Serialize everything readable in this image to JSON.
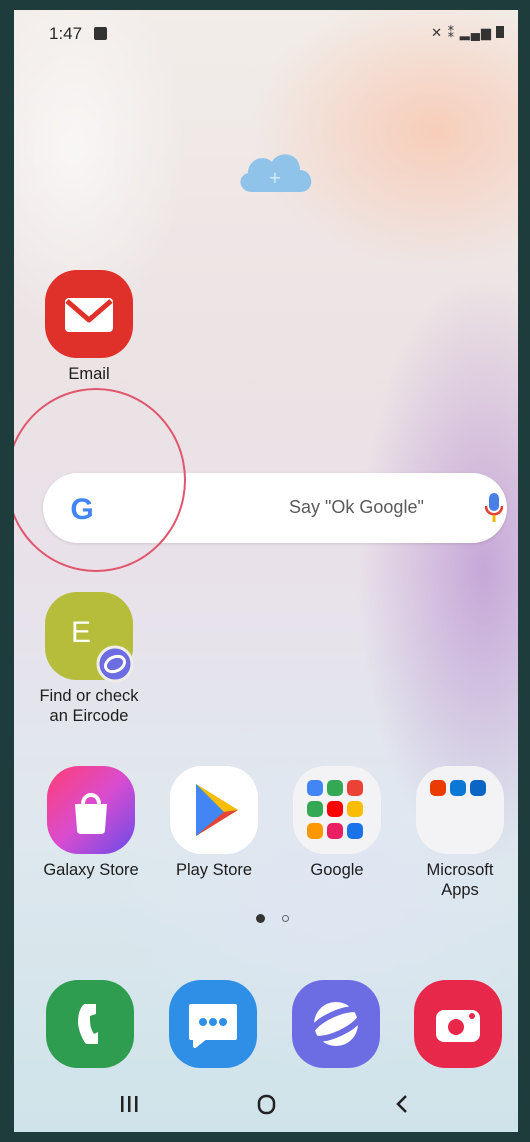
{
  "status_bar": {
    "time": "1:47",
    "notification_icon": "gallery-icon",
    "system_icons": [
      "mute-icon",
      "wifi-calling-icon",
      "signal-icon",
      "battery-icon"
    ]
  },
  "home": {
    "cloud_widget": {
      "icon": "cloud-add-icon",
      "color": "#8fc3ea"
    },
    "email": {
      "label": "Email",
      "color": "#e0302a"
    },
    "search_bar": {
      "brand": "G",
      "hint": "Say \"Ok Google\"",
      "mic_color": "#4a7fe5"
    },
    "eircode": {
      "letter": "E",
      "line1": "Find or check",
      "line2": "an Eircode",
      "color": "#b6bd3a",
      "badge_color": "#6c6de3"
    },
    "apps": [
      {
        "name": "galaxy-store",
        "label": "Galaxy Store",
        "color": "#ff3e73"
      },
      {
        "name": "play-store",
        "label": "Play Store",
        "color": "#ffffff"
      },
      {
        "name": "google-folder",
        "label": "Google"
      },
      {
        "name": "microsoft-apps-folder",
        "label_line1": "Microsoft",
        "label_line2": "Apps"
      }
    ],
    "page_indicator": {
      "pages": 2,
      "current": 1
    },
    "dock": [
      {
        "name": "phone",
        "color": "#2e9d4f"
      },
      {
        "name": "messages",
        "color": "#2f8fe6"
      },
      {
        "name": "internet",
        "color": "#6c6de3"
      },
      {
        "name": "camera",
        "color": "#e8284a"
      }
    ]
  },
  "nav_bar": {
    "recents": "recents-icon",
    "home": "home-icon",
    "back": "back-icon"
  },
  "annotation": {
    "highlight_color": "#e0566c"
  }
}
